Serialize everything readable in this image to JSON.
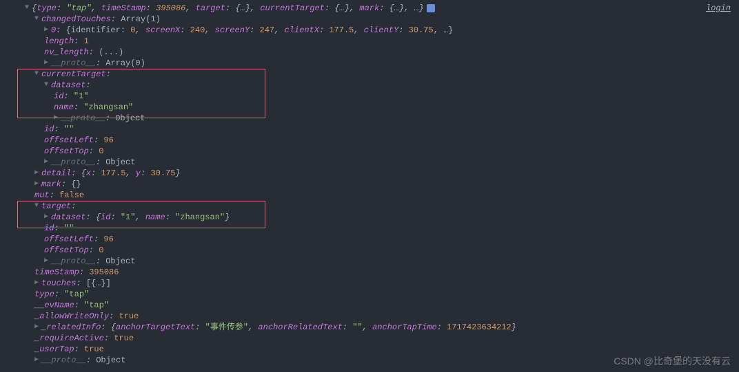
{
  "login": "login",
  "root": {
    "typeKey": "type",
    "typeVal": "\"tap\"",
    "timeStampKey": "timeStamp",
    "timeStampVal": "395086",
    "targetKey": "target",
    "targetPreview": "{…}",
    "currentTargetKey": "currentTarget",
    "currentTargetPreview": "{…}",
    "markKey": "mark",
    "markPreview": "{…}",
    "trailing": ", …}"
  },
  "changedTouches": {
    "label": "changedTouches",
    "preview": "Array(1)",
    "item0Key": "0",
    "item0Preview": "{identifier: ",
    "identifier": "0",
    "screenXKey": "screenX",
    "screenX": "240",
    "screenYKey": "screenY",
    "screenY": "247",
    "clientXKey": "clientX",
    "clientX": "177.5",
    "clientYKey": "clientY",
    "clientY": "30.75",
    "trail": ", …}",
    "lengthKey": "length",
    "lengthVal": "1",
    "nvLengthKey": "nv_length",
    "nvLengthVal": "(...)",
    "protoKey": "__proto__",
    "protoVal": "Array(0)"
  },
  "currentTarget": {
    "label": "currentTarget",
    "datasetKey": "dataset",
    "idKey": "id",
    "idVal": "\"1\"",
    "nameKey": "name",
    "nameVal": "\"zhangsan\"",
    "protoKey": "__proto__",
    "protoVal": "Object",
    "outerIdKey": "id",
    "outerIdVal": "\"\"",
    "offsetLeftKey": "offsetLeft",
    "offsetLeftVal": "96",
    "offsetTopKey": "offsetTop",
    "offsetTopVal": "0",
    "proto2Key": "__proto__",
    "proto2Val": "Object"
  },
  "detail": {
    "key": "detail",
    "xKey": "x",
    "xVal": "177.5",
    "yKey": "y",
    "yVal": "30.75"
  },
  "mark": {
    "key": "mark",
    "val": "{}"
  },
  "mut": {
    "key": "mut",
    "val": "false"
  },
  "target": {
    "label": "target",
    "datasetKey": "dataset",
    "datasetIdKey": "id",
    "datasetIdVal": "\"1\"",
    "datasetNameKey": "name",
    "datasetNameVal": "\"zhangsan\"",
    "idKey": "id",
    "idVal": "\"\"",
    "offsetLeftKey": "offsetLeft",
    "offsetLeftVal": "96",
    "offsetTopKey": "offsetTop",
    "offsetTopVal": "0",
    "protoKey": "__proto__",
    "protoVal": "Object"
  },
  "timeStamp": {
    "key": "timeStamp",
    "val": "395086"
  },
  "touches": {
    "key": "touches",
    "val": "[{…}]"
  },
  "type": {
    "key": "type",
    "val": "\"tap\""
  },
  "evName": {
    "key": "__evName",
    "val": "\"tap\""
  },
  "allowWriteOnly": {
    "key": "_allowWriteOnly",
    "val": "true"
  },
  "relatedInfo": {
    "key": "_relatedInfo",
    "anchorTargetTextKey": "anchorTargetText",
    "anchorTargetTextVal": "\"事件传参\"",
    "anchorRelatedTextKey": "anchorRelatedText",
    "anchorRelatedTextVal": "\"\"",
    "anchorTapTimeKey": "anchorTapTime",
    "anchorTapTimeVal": "1717423634212"
  },
  "requireActive": {
    "key": "_requireActive",
    "val": "true"
  },
  "userTap": {
    "key": "_userTap",
    "val": "true"
  },
  "finalProto": {
    "key": "__proto__",
    "val": "Object"
  },
  "watermark": "CSDN @比奇堡的天没有云"
}
